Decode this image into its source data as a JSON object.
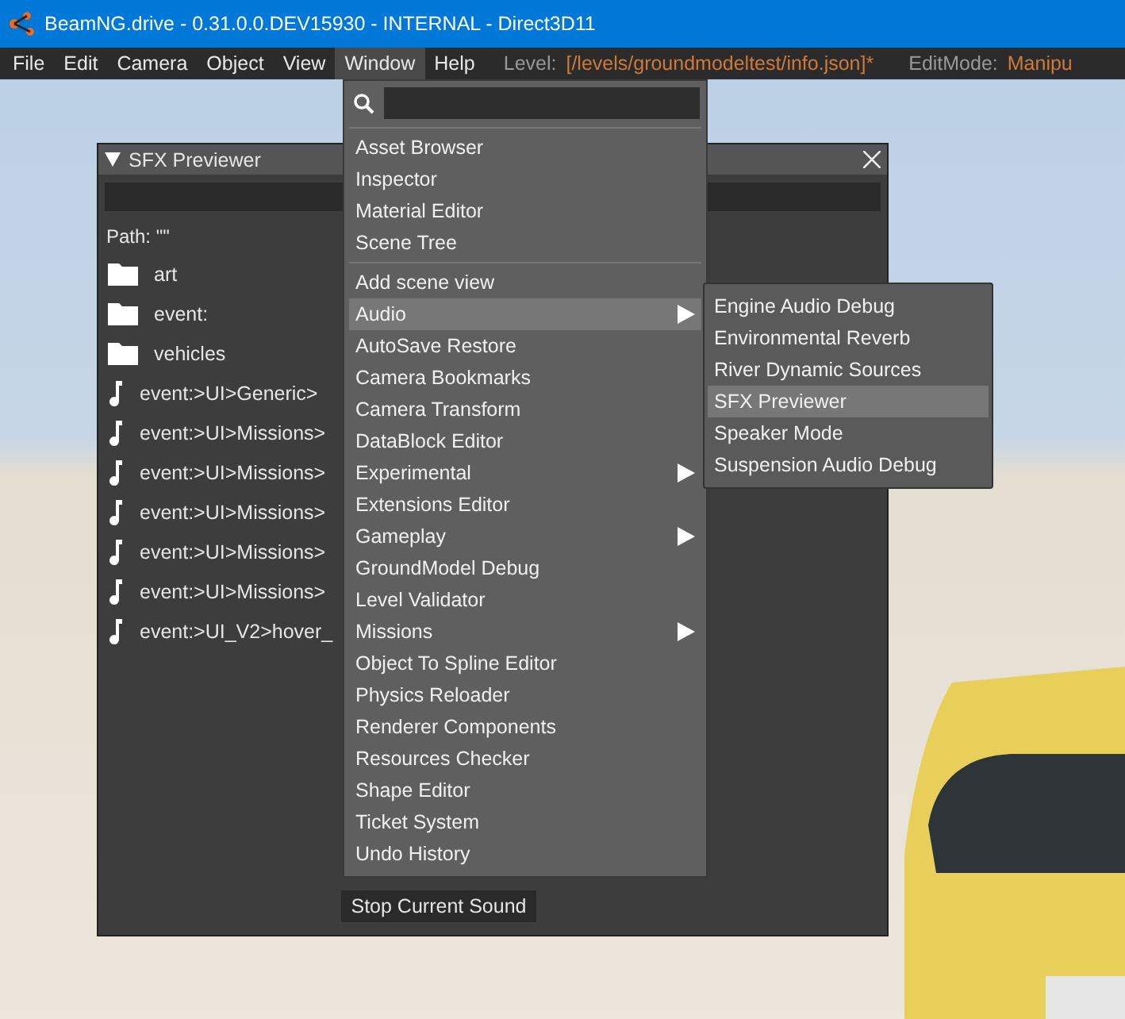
{
  "window": {
    "title": "BeamNG.drive - 0.31.0.0.DEV15930 - INTERNAL - Direct3D11"
  },
  "menu_bar": {
    "items": [
      {
        "label": "File",
        "selected": false
      },
      {
        "label": "Edit",
        "selected": false
      },
      {
        "label": "Camera",
        "selected": false
      },
      {
        "label": "Object",
        "selected": false
      },
      {
        "label": "View",
        "selected": false
      },
      {
        "label": "Window",
        "selected": true
      },
      {
        "label": "Help",
        "selected": false
      }
    ],
    "level_label": "Level:",
    "level_value": "[/levels/groundmodeltest/info.json]*",
    "editmode_label": "EditMode:",
    "editmode_value": "Manipu"
  },
  "sfx_previewer": {
    "title": "SFX Previewer",
    "expanded": true,
    "path": "Path: \"\"",
    "entries": [
      {
        "kind": "folder",
        "label": "art"
      },
      {
        "kind": "folder",
        "label": "event:"
      },
      {
        "kind": "folder",
        "label": "vehicles"
      },
      {
        "kind": "sound",
        "label": "event:>UI>Generic>"
      },
      {
        "kind": "sound",
        "label": "event:>UI>Missions>"
      },
      {
        "kind": "sound",
        "label": "event:>UI>Missions>"
      },
      {
        "kind": "sound",
        "label": "event:>UI>Missions>"
      },
      {
        "kind": "sound",
        "label": "event:>UI>Missions>"
      },
      {
        "kind": "sound",
        "label": "event:>UI>Missions>"
      },
      {
        "kind": "sound",
        "label": "event:>UI_V2>hover_"
      }
    ],
    "button": "Stop Current Sound"
  },
  "window_menu": {
    "sections": [
      [
        {
          "label": "Asset Browser",
          "has_submenu": false,
          "selected": false
        },
        {
          "label": "Inspector",
          "has_submenu": false,
          "selected": false
        },
        {
          "label": "Material Editor",
          "has_submenu": false,
          "selected": false
        },
        {
          "label": "Scene Tree",
          "has_submenu": false,
          "selected": false
        }
      ],
      [
        {
          "label": "Add scene view",
          "has_submenu": false,
          "selected": false
        },
        {
          "label": "Audio",
          "has_submenu": true,
          "selected": true
        },
        {
          "label": "AutoSave Restore",
          "has_submenu": false,
          "selected": false
        },
        {
          "label": "Camera Bookmarks",
          "has_submenu": false,
          "selected": false
        },
        {
          "label": "Camera Transform",
          "has_submenu": false,
          "selected": false
        },
        {
          "label": "DataBlock Editor",
          "has_submenu": false,
          "selected": false
        },
        {
          "label": "Experimental",
          "has_submenu": true,
          "selected": false
        },
        {
          "label": "Extensions Editor",
          "has_submenu": false,
          "selected": false
        },
        {
          "label": "Gameplay",
          "has_submenu": true,
          "selected": false
        },
        {
          "label": "GroundModel Debug",
          "has_submenu": false,
          "selected": false
        },
        {
          "label": "Level Validator",
          "has_submenu": false,
          "selected": false
        },
        {
          "label": "Missions",
          "has_submenu": true,
          "selected": false
        },
        {
          "label": "Object To Spline Editor",
          "has_submenu": false,
          "selected": false
        },
        {
          "label": "Physics Reloader",
          "has_submenu": false,
          "selected": false
        },
        {
          "label": "Renderer Components",
          "has_submenu": false,
          "selected": false
        },
        {
          "label": "Resources Checker",
          "has_submenu": false,
          "selected": false
        },
        {
          "label": "Shape Editor",
          "has_submenu": false,
          "selected": false
        },
        {
          "label": "Ticket System",
          "has_submenu": false,
          "selected": false
        },
        {
          "label": "Undo History",
          "has_submenu": false,
          "selected": false
        }
      ]
    ]
  },
  "audio_submenu": {
    "items": [
      {
        "label": "Engine Audio Debug",
        "selected": false
      },
      {
        "label": "Environmental Reverb",
        "selected": false
      },
      {
        "label": "River Dynamic Sources",
        "selected": false
      },
      {
        "label": "SFX Previewer",
        "selected": true
      },
      {
        "label": "Speaker Mode",
        "selected": false
      },
      {
        "label": "Suspension Audio Debug",
        "selected": false
      }
    ]
  }
}
